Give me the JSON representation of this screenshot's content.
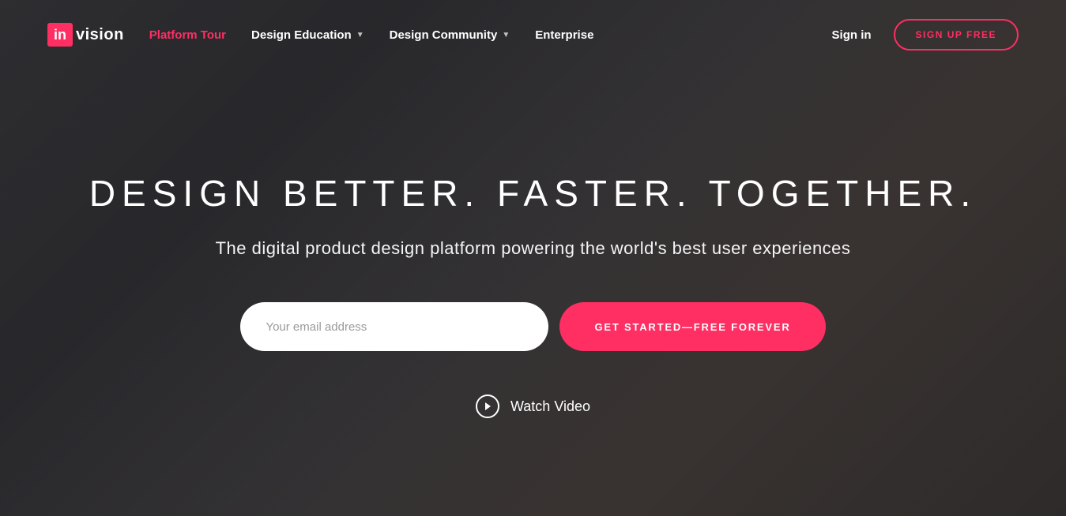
{
  "logo": {
    "box_text": "in",
    "text": "vision"
  },
  "nav": {
    "items": [
      {
        "label": "Platform Tour",
        "active": true,
        "dropdown": false
      },
      {
        "label": "Design Education",
        "active": false,
        "dropdown": true
      },
      {
        "label": "Design Community",
        "active": false,
        "dropdown": true
      },
      {
        "label": "Enterprise",
        "active": false,
        "dropdown": false
      }
    ]
  },
  "header": {
    "signin": "Sign in",
    "signup": "SIGN UP FREE"
  },
  "hero": {
    "title": "DESIGN BETTER. FASTER. TOGETHER.",
    "subtitle": "The digital product design platform powering the world's best user experiences",
    "email_placeholder": "Your email address",
    "cta": "GET STARTED—FREE FOREVER",
    "watch_video": "Watch Video"
  },
  "colors": {
    "accent": "#ff2e63"
  }
}
